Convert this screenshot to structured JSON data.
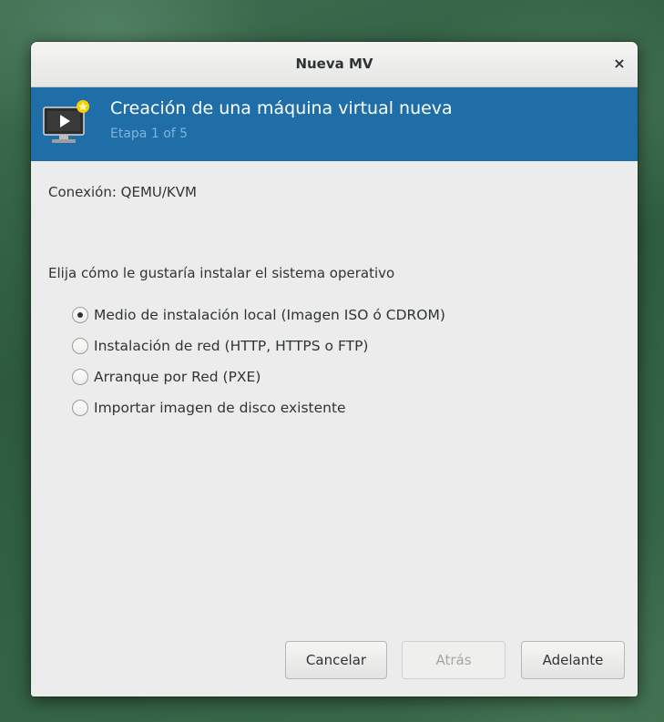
{
  "window": {
    "title": "Nueva MV",
    "close_glyph": "×"
  },
  "banner": {
    "title": "Creación de una máquina virtual nueva",
    "subtitle": "Etapa 1 of 5",
    "icon": "new-vm-monitor-icon",
    "background_color": "#1f6ea8"
  },
  "connection": {
    "text": "Conexión:  QEMU/KVM"
  },
  "install": {
    "prompt": "Elija cómo le gustaría instalar el sistema operativo",
    "selected_index": 0,
    "options": [
      {
        "label": "Medio de instalación local (Imagen ISO ó CDROM)",
        "selected": true
      },
      {
        "label": "Instalación de red (HTTP, HTTPS o FTP)",
        "selected": false
      },
      {
        "label": "Arranque por Red (PXE)",
        "selected": false
      },
      {
        "label": "Importar imagen de disco existente",
        "selected": false
      }
    ]
  },
  "buttons": {
    "cancel": {
      "label": "Cancelar",
      "enabled": true
    },
    "back": {
      "label": "Atrás",
      "enabled": false
    },
    "forward": {
      "label": "Adelante",
      "enabled": true
    }
  }
}
